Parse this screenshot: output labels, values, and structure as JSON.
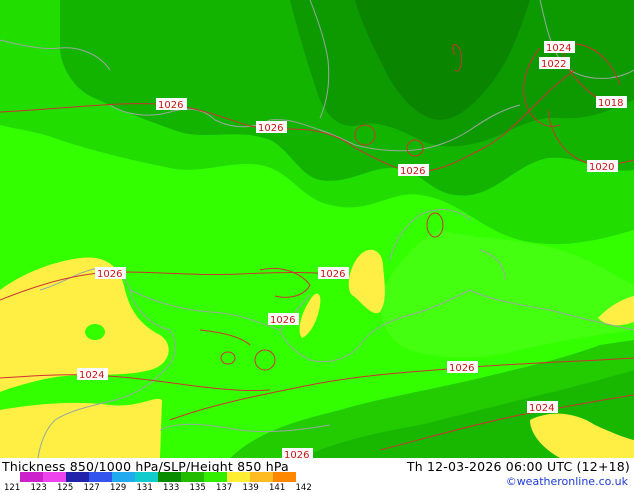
{
  "map": {
    "colors": {
      "ocean_land_light": "#33ff00",
      "medium_green": "#22dd00",
      "dark_green": "#0c9a00",
      "darker_green": "#0a8c00",
      "yellow": "#ffee44",
      "isobar": "#cc3333",
      "coastline": "#9aa8a0"
    },
    "isobar_labels": [
      "1026",
      "1026",
      "1026",
      "1026",
      "1026",
      "1026",
      "1026",
      "1026",
      "1024",
      "1022",
      "1018",
      "1020",
      "1024",
      "1024",
      "1026"
    ]
  },
  "footer": {
    "title": "Thickness 850/1000 hPa/SLP/Height 850 hPa",
    "valid_time": "Th 12-03-2026 06:00 UTC (12+18)",
    "credit": "©weatheronline.co.uk",
    "legend": {
      "ticks": [
        "121",
        "123",
        "125",
        "127",
        "129",
        "131",
        "133",
        "135",
        "137",
        "139",
        "141",
        "142"
      ],
      "colors": [
        "#cc22cc",
        "#ee44ee",
        "#2222aa",
        "#3355ee",
        "#22aaee",
        "#11cccc",
        "#0a8c00",
        "#22bb00",
        "#33ee00",
        "#ffee33",
        "#ffbb22",
        "#ff8800"
      ]
    }
  }
}
